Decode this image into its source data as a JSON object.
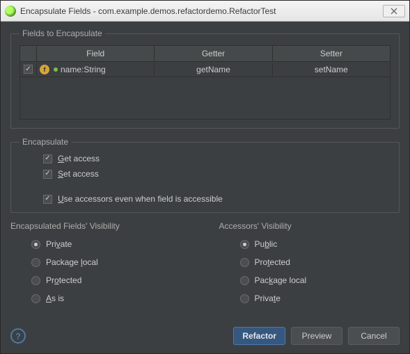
{
  "window": {
    "title": "Encapsulate Fields - com.example.demos.refactordemo.RefactorTest"
  },
  "fields_section": {
    "legend": "Fields to Encapsulate",
    "headers": {
      "field": "Field",
      "getter": "Getter",
      "setter": "Setter"
    },
    "rows": [
      {
        "checked": true,
        "field_label": "name:String",
        "getter": "getName",
        "setter": "setName"
      }
    ]
  },
  "encapsulate": {
    "legend": "Encapsulate",
    "get_access": {
      "u": "G",
      "rest": "et access"
    },
    "set_access": {
      "u": "S",
      "rest": "et access"
    },
    "use_accessors": {
      "u": "U",
      "rest": "se accessors even when field is accessible"
    }
  },
  "field_visibility": {
    "header": "Encapsulated Fields' Visibility",
    "options": {
      "private": {
        "pre": "Pri",
        "u": "v",
        "post": "ate"
      },
      "package": {
        "pre": "Package ",
        "u": "l",
        "post": "ocal"
      },
      "protected": {
        "pre": "Pr",
        "u": "o",
        "post": "tected"
      },
      "asis": {
        "pre": "",
        "u": "A",
        "post": "s is"
      }
    },
    "selected": "private"
  },
  "accessor_visibility": {
    "header": "Accessors' Visibility",
    "options": {
      "public": {
        "pre": "Pu",
        "u": "b",
        "post": "lic"
      },
      "protected": {
        "pre": "Pro",
        "u": "t",
        "post": "ected"
      },
      "package": {
        "pre": "Pac",
        "u": "k",
        "post": "age local"
      },
      "private": {
        "pre": "Priva",
        "u": "t",
        "post": "e"
      }
    },
    "selected": "public"
  },
  "buttons": {
    "refactor": "Refactor",
    "preview": "Preview",
    "cancel": "Cancel"
  }
}
